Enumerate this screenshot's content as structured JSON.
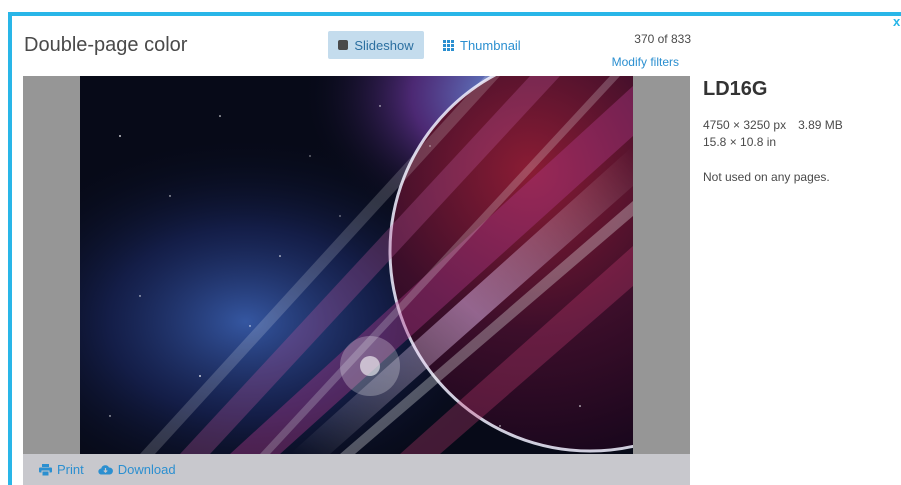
{
  "header": {
    "title": "Double-page color",
    "slideshow_label": "Slideshow",
    "thumbnail_label": "Thumbnail",
    "counter": "370 of 833",
    "modify_filters": "Modify filters",
    "close": "x"
  },
  "footer": {
    "print_label": "Print",
    "download_label": "Download"
  },
  "details": {
    "name": "LD16G",
    "dimensions_px": "4750 × 3250 px",
    "file_size": "3.89 MB",
    "dimensions_in": "15.8 × 10.8 in",
    "usage": "Not used on any pages."
  },
  "colors": {
    "accent": "#29b6e8",
    "link": "#2b8fd0",
    "slideshow_active_bg": "#c4dced"
  },
  "icons": {
    "slideshow": "square-icon",
    "thumbnail": "grid-icon",
    "print": "printer-icon",
    "download": "cloud-download-icon"
  }
}
